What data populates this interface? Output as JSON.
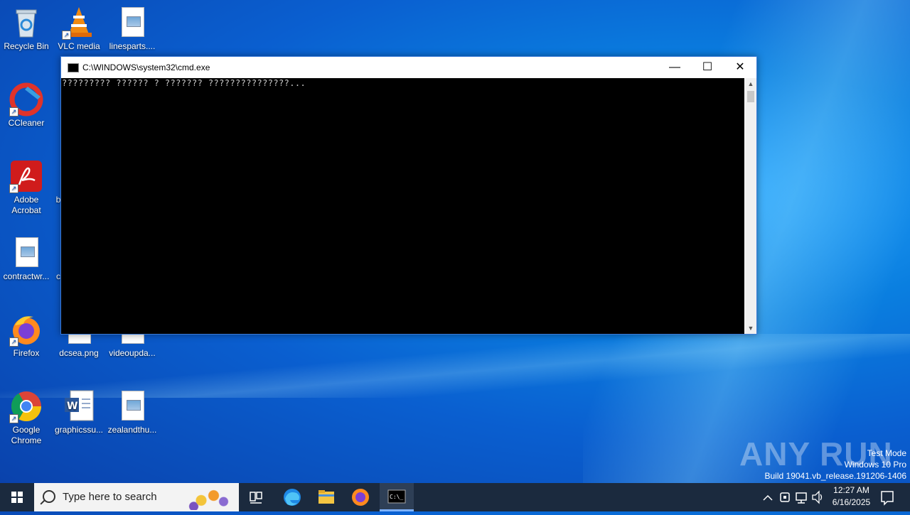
{
  "desktop": {
    "icons": [
      {
        "label": "Recycle Bin"
      },
      {
        "label": "VLC media"
      },
      {
        "label": "linesparts...."
      },
      {
        "label": "CCleaner"
      },
      {
        "label": "Adobe Acrobat"
      },
      {
        "label": "b"
      },
      {
        "label": "contractwr..."
      },
      {
        "label": "c"
      },
      {
        "label": "Firefox"
      },
      {
        "label": "dcsea.png"
      },
      {
        "label": "videoupda..."
      },
      {
        "label": "Google Chrome"
      },
      {
        "label": "graphicssu..."
      },
      {
        "label": "zealandthu..."
      }
    ]
  },
  "cmd_window": {
    "title": "C:\\WINDOWS\\system32\\cmd.exe",
    "output_line": "????????? ?????? ? ??????? ???????????????...",
    "minimize_glyph": "—",
    "maximize_glyph": "☐",
    "close_glyph": "✕"
  },
  "watermark": {
    "logo_text": "ANY RUN",
    "line1": "Test Mode",
    "line2": "Windows 10 Pro",
    "line3": "Build 19041.vb_release.191206-1406"
  },
  "taskbar": {
    "search_placeholder": "Type here to search",
    "time": "12:27 AM",
    "date": "6/16/2025",
    "apps": [
      "task-view",
      "edge",
      "file-explorer",
      "firefox",
      "cmd"
    ]
  }
}
